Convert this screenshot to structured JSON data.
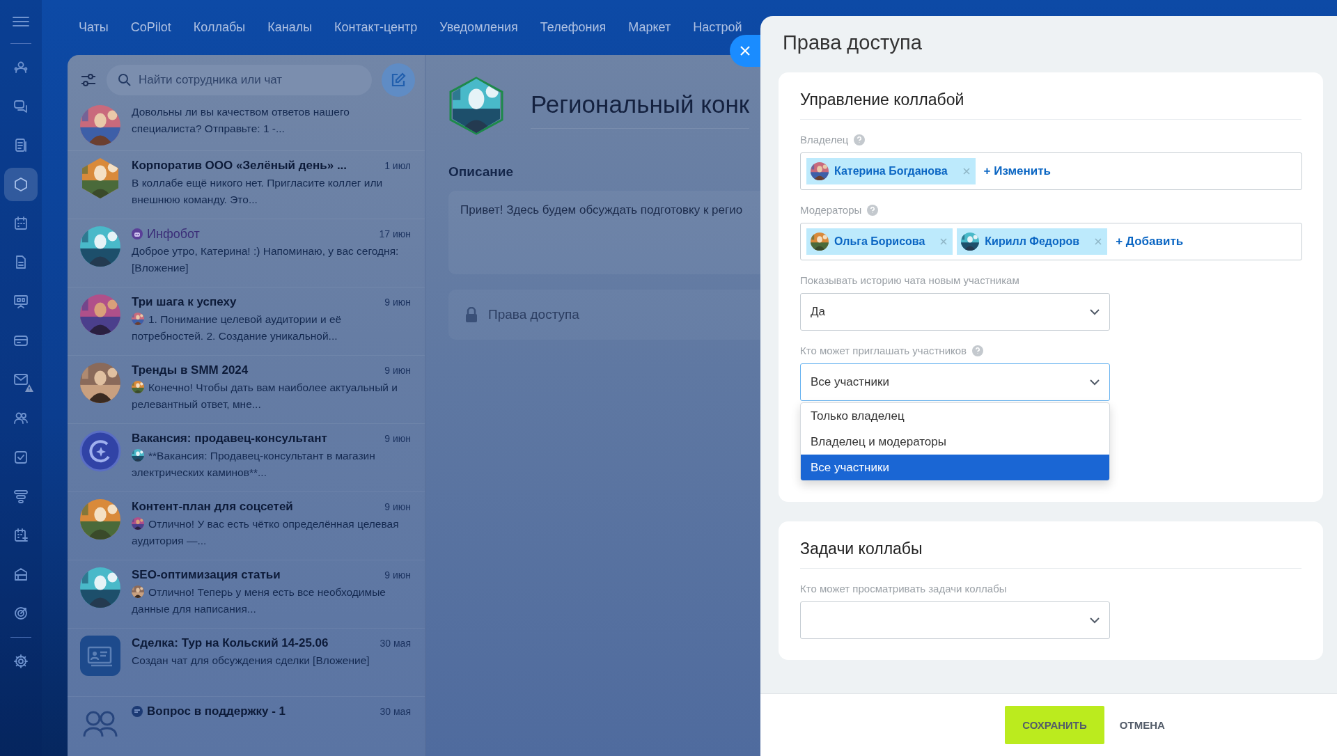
{
  "rail": {
    "items": [
      {
        "kind": "users",
        "selected": false
      },
      {
        "kind": "chat",
        "selected": false
      },
      {
        "kind": "document",
        "selected": false
      },
      {
        "kind": "hexagon",
        "selected": true
      },
      {
        "kind": "calendar",
        "selected": false
      },
      {
        "kind": "file",
        "selected": false
      },
      {
        "kind": "board",
        "selected": false
      },
      {
        "kind": "card",
        "selected": false
      },
      {
        "kind": "mail",
        "selected": false,
        "warning": true
      },
      {
        "kind": "people",
        "selected": false
      },
      {
        "kind": "task",
        "selected": false
      },
      {
        "kind": "filter",
        "selected": false
      },
      {
        "kind": "schedule",
        "selected": false
      },
      {
        "kind": "store",
        "selected": false
      },
      {
        "kind": "target",
        "selected": false
      },
      {
        "kind": "gear",
        "selected": false
      }
    ]
  },
  "top_nav": [
    "Чаты",
    "CoPilot",
    "Коллабы",
    "Каналы",
    "Контакт-центр",
    "Уведомления",
    "Телефония",
    "Маркет",
    "Настрой"
  ],
  "chat_list": {
    "search": {
      "placeholder": "Найти сотрудника или чат"
    },
    "chats": [
      {
        "preview": "Довольны ли вы качеством ответов нашего специалиста? Отправьте: 1 -..."
      },
      {
        "title": "Корпоратив ООО «Зелёный день» ...",
        "date": "1 июл",
        "kind": "hexagon",
        "preview": "В коллабе ещё никого нет. Пригласите коллег или внешнюю команду. Это..."
      },
      {
        "title": "Инфобот",
        "kind": "bot",
        "date": "17 июн",
        "preview": "Доброе утро, Катерина! :) Напоминаю, у вас сегодня: [Вложение]"
      },
      {
        "title": "Три шага к успеху",
        "date": "9 июн",
        "sender": true,
        "preview": "1. Понимание целевой аудитории и её потребностей. 2. Создание уникальной..."
      },
      {
        "title": "Тренды в SMM 2024",
        "date": "9 июн",
        "sender": true,
        "preview": "Конечно! Чтобы дать вам наиболее актуальный и релевантный ответ, мне..."
      },
      {
        "title": "Вакансия: продавец-консультант",
        "date": "9 июн",
        "kind": "copilot",
        "sender": true,
        "preview": "**Вакансия: Продавец-консультант в магазин электрических каминов**..."
      },
      {
        "title": "Контент-план для соцсетей",
        "date": "9 июн",
        "sender": true,
        "preview": "Отлично! У вас есть чётко определённая целевая аудитория —..."
      },
      {
        "title": "SEO-оптимизация статьи",
        "date": "9 июн",
        "sender": true,
        "preview": "Отлично! Теперь у меня есть все необходимые данные для написания..."
      },
      {
        "title": "Сделка: Тур на Кольский 14-25.06",
        "date": "30 мая",
        "kind": "deal",
        "preview": "Создан чат для обсуждения сделки [Вложение]"
      },
      {
        "title": "Вопрос в поддержку - 1",
        "kind": "support",
        "date": "30 мая"
      }
    ]
  },
  "collab": {
    "title": "Региональный конк",
    "description_label": "Описание",
    "description": "Привет! Здесь будем обсуждать подготовку к регио",
    "access_label": "Права доступа"
  },
  "panel": {
    "title": "Права доступа",
    "sections": [
      {
        "title": "Управление коллабой",
        "fields": [
          {
            "kind": "people",
            "label": "Владелец",
            "help": true,
            "people": [
              "Катерина Богданова"
            ],
            "action": "+ Изменить"
          },
          {
            "kind": "people",
            "label": "Модераторы",
            "help": true,
            "people": [
              "Ольга Борисова",
              "Кирилл Федоров"
            ],
            "action": "+ Добавить"
          },
          {
            "kind": "select",
            "label": "Показывать историю чата новым участникам",
            "value": "Да",
            "expanded": false
          },
          {
            "kind": "select",
            "label": "Кто может приглашать участников",
            "help": true,
            "value": "Все участники",
            "expanded": true,
            "options": [
              {
                "label": "Только владелец",
                "selected": false
              },
              {
                "label": "Владелец и модераторы",
                "selected": false
              },
              {
                "label": "Все участники",
                "selected": true
              }
            ]
          }
        ]
      },
      {
        "title": "Задачи коллабы",
        "fields": [
          {
            "kind": "select",
            "label": "Кто может просматривать задачи коллабы",
            "expanded": false
          }
        ]
      }
    ],
    "buttons": [
      {
        "label": "СОХРАНИТЬ",
        "kind": "primary"
      },
      {
        "label": "ОТМЕНА",
        "kind": "link"
      }
    ]
  }
}
